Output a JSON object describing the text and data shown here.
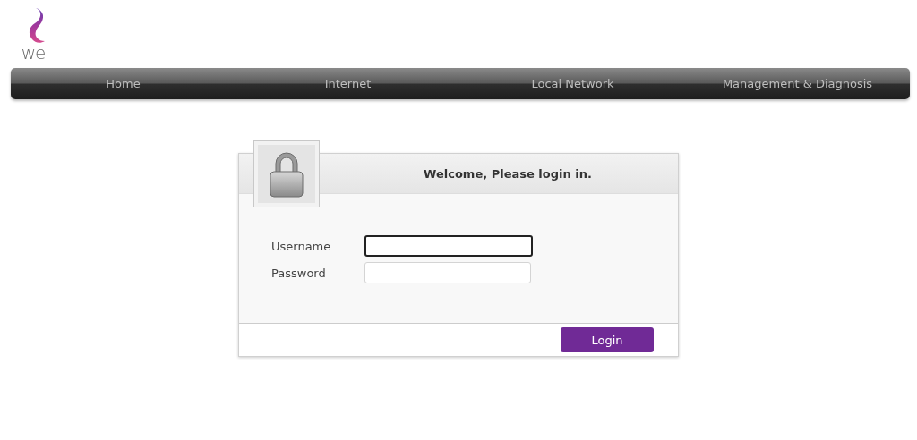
{
  "logo": {
    "text": "we"
  },
  "nav": {
    "items": [
      {
        "label": "Home"
      },
      {
        "label": "Internet"
      },
      {
        "label": "Local Network"
      },
      {
        "label": "Management & Diagnosis"
      }
    ]
  },
  "login": {
    "title": "Welcome, Please login in.",
    "fields": [
      {
        "label": "Username",
        "focused": true
      },
      {
        "label": "Password",
        "focused": false
      }
    ],
    "button": "Login"
  }
}
